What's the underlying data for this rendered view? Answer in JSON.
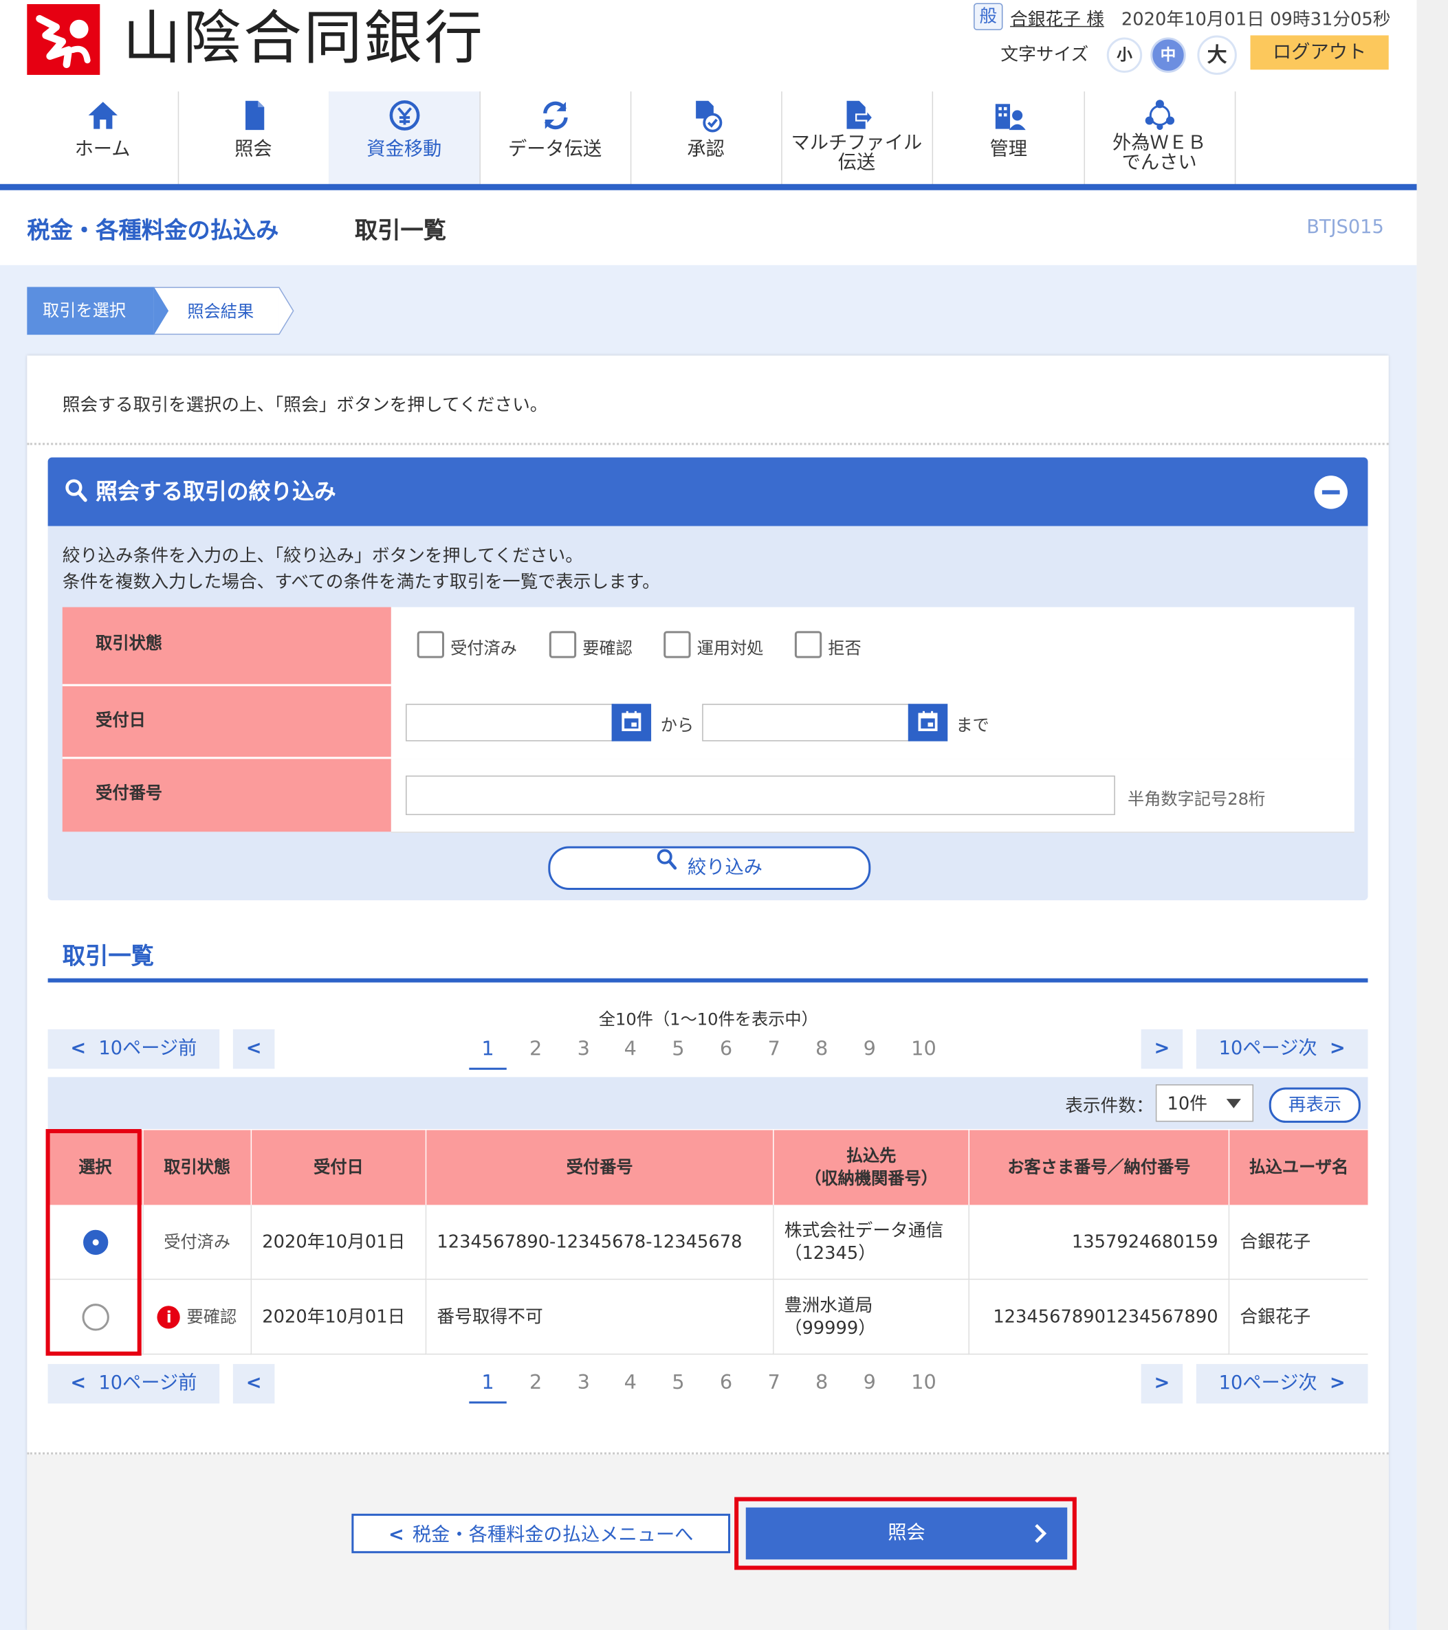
{
  "header": {
    "bank_name": "山陰合同銀行",
    "user_badge": "般",
    "user_name": "合銀花子 様",
    "datetime": "2020年10月01日 09時31分05秒",
    "font_size_label": "文字サイズ",
    "font_sizes": [
      "小",
      "中",
      "大"
    ],
    "logout": "ログアウト",
    "accent_color": "#2d62c8",
    "logo_color": "#e60012"
  },
  "nav": [
    {
      "label": "ホーム",
      "icon": "home-icon"
    },
    {
      "label": "照会",
      "icon": "document-icon"
    },
    {
      "label": "資金移動",
      "icon": "yen-transfer-icon",
      "active": true
    },
    {
      "label": "データ伝送",
      "icon": "sync-icon"
    },
    {
      "label": "承認",
      "icon": "approve-icon"
    },
    {
      "label": "マルチファイル\n伝送",
      "icon": "file-transfer-icon"
    },
    {
      "label": "管理",
      "icon": "admin-icon"
    },
    {
      "label": "外為ＷＥＢ\nでんさい",
      "icon": "network-icon"
    }
  ],
  "page": {
    "title": "税金・各種料金の払込み",
    "subtitle": "取引一覧",
    "code": "BTJS015"
  },
  "steps": [
    "取引を選択",
    "照会結果"
  ],
  "instruction": "照会する取引を選択の上、「照会」ボタンを押してください。",
  "filter": {
    "title": "照会する取引の絞り込み",
    "desc1": "絞り込み条件を入力の上、「絞り込み」ボタンを押してください。",
    "desc2": "条件を複数入力した場合、すべての条件を満たす取引を一覧で表示します。",
    "status_label": "取引状態",
    "status_options": [
      "受付済み",
      "要確認",
      "運用対処",
      "拒否"
    ],
    "date_label": "受付日",
    "date_from_suffix": "から",
    "date_to_suffix": "まで",
    "number_label": "受付番号",
    "number_hint": "半角数字記号28桁",
    "button": "絞り込み"
  },
  "list": {
    "title": "取引一覧",
    "count_text": "全10件（1～10件を表示中）",
    "prev10": "10ページ前",
    "next10": "10ページ次",
    "pages": [
      "1",
      "2",
      "3",
      "4",
      "5",
      "6",
      "7",
      "8",
      "9",
      "10"
    ],
    "current_page": "1",
    "display_count_label": "表示件数：",
    "display_count_value": "10件",
    "redisplay": "再表示",
    "columns": [
      "選択",
      "取引状態",
      "受付日",
      "受付番号",
      "払込先\n（収納機関番号）",
      "お客さま番号／納付番号",
      "払込ユーザ名"
    ],
    "rows": [
      {
        "selected": true,
        "status": "受付済み",
        "warn": false,
        "date": "2020年10月01日",
        "number": "1234567890-12345678-12345678",
        "payee": "株式会社データ通信",
        "payee_code": "（12345）",
        "customer_no": "1357924680159",
        "user": "合銀花子"
      },
      {
        "selected": false,
        "status": "要確認",
        "warn": true,
        "date": "2020年10月01日",
        "number": "番号取得不可",
        "payee": "豊洲水道局",
        "payee_code": "（99999）",
        "customer_no": "12345678901234567890",
        "user": "合銀花子"
      }
    ]
  },
  "footer": {
    "back": "税金・各種料金の払込メニューへ",
    "inquiry": "照会"
  }
}
